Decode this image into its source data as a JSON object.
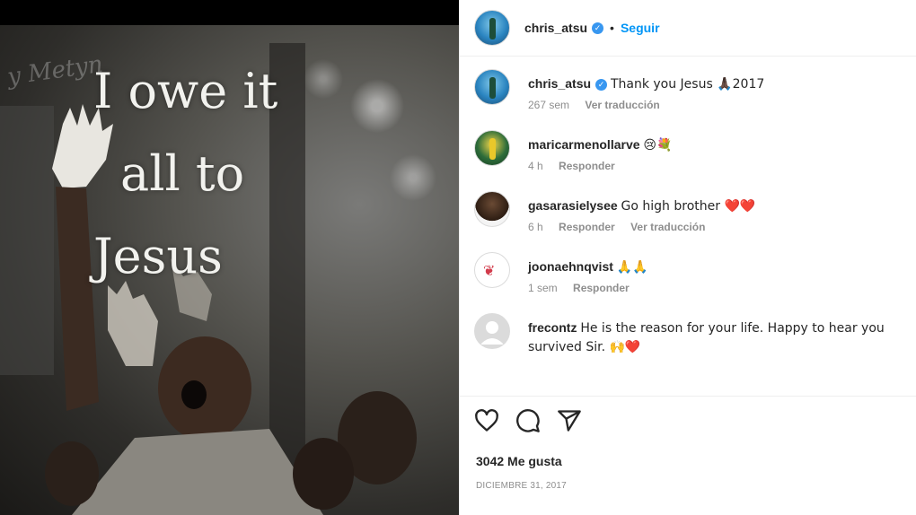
{
  "photo": {
    "quote_lines": [
      "I owe it",
      "all to",
      "Jesus"
    ],
    "watermark": "y Metyn"
  },
  "header": {
    "username": "chris_atsu",
    "separator": "•",
    "follow_label": "Seguir"
  },
  "comments": [
    {
      "username": "chris_atsu",
      "verified": true,
      "text": "Thank you Jesus 🙏🏿2017",
      "time": "267 sem",
      "actions": [
        "Ver traducción"
      ]
    },
    {
      "username": "maricarmenollarve",
      "verified": false,
      "text": "😢💐",
      "time": "4 h",
      "actions": [
        "Responder"
      ]
    },
    {
      "username": "gasarasielysee",
      "verified": false,
      "text": "Go high brother ❤️❤️",
      "time": "6 h",
      "actions": [
        "Responder",
        "Ver traducción"
      ]
    },
    {
      "username": "joonaehnqvist",
      "verified": false,
      "text": "🙏🙏",
      "time": "1 sem",
      "actions": [
        "Responder"
      ]
    },
    {
      "username": "frecontz",
      "verified": false,
      "text": "He is the reason for your life. Happy to hear you survived Sir. 🙌❤️",
      "time": "",
      "actions": []
    }
  ],
  "likes": "3042 Me gusta",
  "date": "DICIEMBRE 31, 2017",
  "icons": [
    "heart-icon",
    "comment-icon",
    "share-icon",
    "verified-icon"
  ],
  "colors": {
    "accent": "#0095f6",
    "verified": "#3897f0",
    "muted": "#8e8e8e"
  }
}
